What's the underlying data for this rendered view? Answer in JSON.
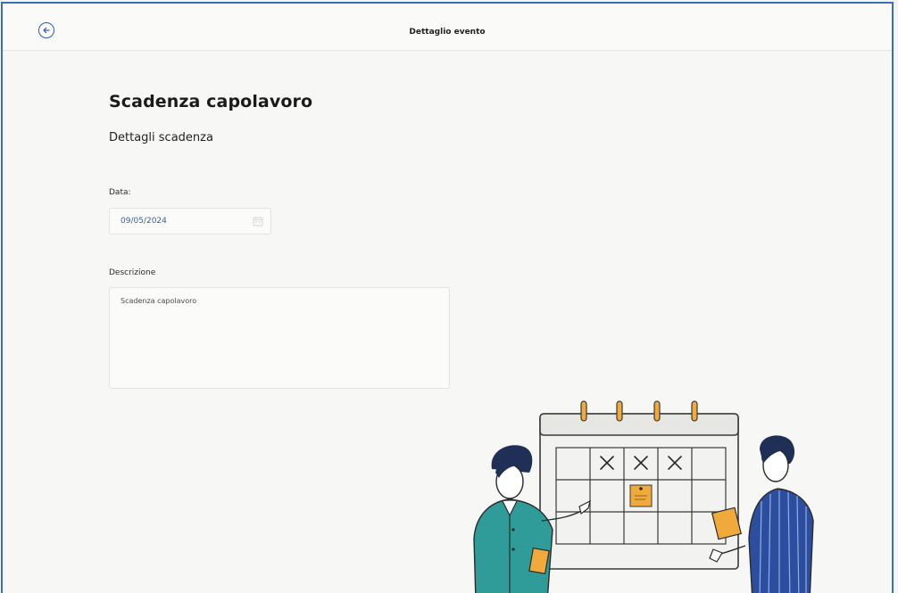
{
  "header": {
    "title": "Dettaglio evento",
    "back_icon": "arrow-left-circle-icon"
  },
  "main": {
    "title": "Scadenza capolavoro",
    "section_title": "Dettagli scadenza",
    "date": {
      "label": "Data:",
      "value": "09/05/2024",
      "icon": "calendar-icon"
    },
    "description": {
      "label": "Descrizione",
      "value": "Scadenza capolavoro"
    }
  },
  "illustration": {
    "subject": "calendar-with-two-people",
    "crossed_days": 3
  },
  "colors": {
    "accent": "#2d5fa8",
    "frame_border": "#3d6fb6",
    "note_orange": "#f0a93b"
  }
}
